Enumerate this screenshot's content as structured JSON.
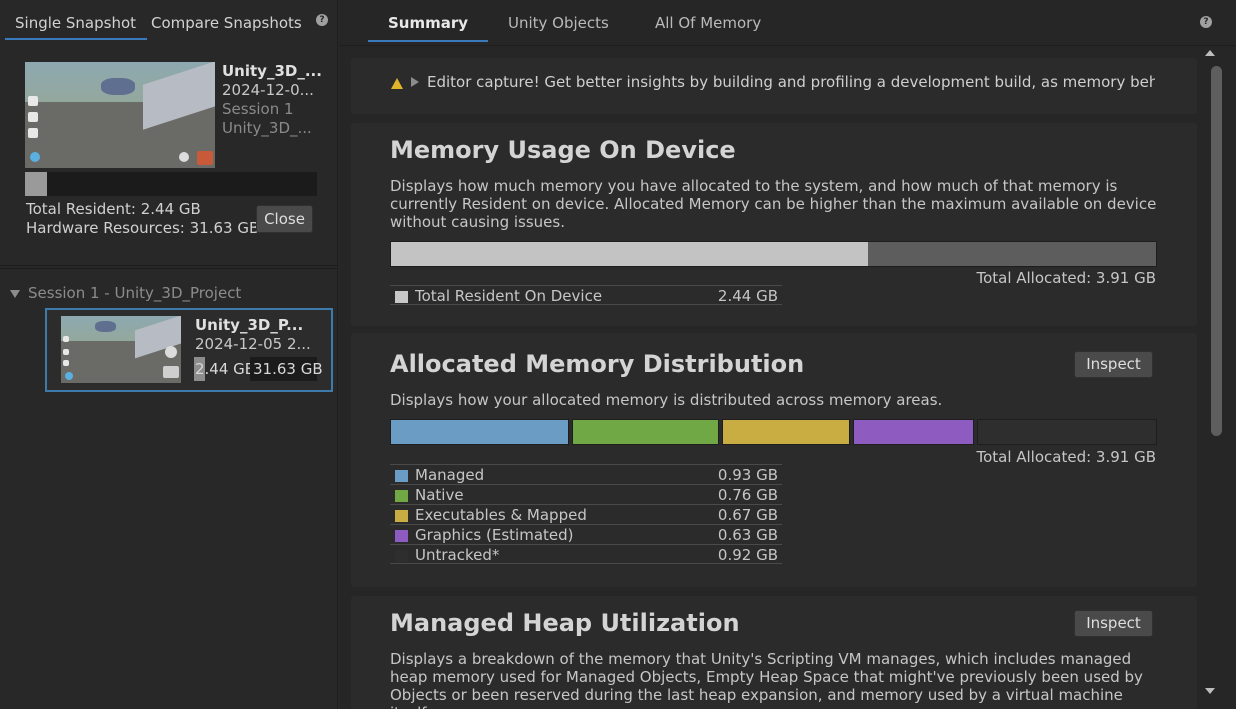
{
  "left_tabs": {
    "single": "Single Snapshot",
    "compare": "Compare Snapshots",
    "help": "?"
  },
  "snapshot": {
    "title": "Unity_3D_...",
    "date": "2024-12-0...",
    "session": "Session 1",
    "project": "Unity_3D_...",
    "usage_fraction": 0.077,
    "total_resident": "Total Resident: 2.44 GB",
    "hardware_resources": "Hardware Resources: 31.63 GB",
    "close_label": "Close"
  },
  "session_tree": {
    "header": "Session 1 - Unity_3D_Project",
    "item": {
      "title": "Unity_3D_P...",
      "date": "2024-12-05 2...",
      "resident": "2.44 GB",
      "hardware": "31.63 GB"
    }
  },
  "right_tabs": {
    "summary": "Summary",
    "objects": "Unity Objects",
    "all": "All Of Memory",
    "help": "?"
  },
  "warning": "Editor capture! Get better insights by building and profiling a development build, as memory behaves q",
  "memory_usage": {
    "title": "Memory Usage On Device",
    "description": "Displays how much memory you have allocated to the system, and how much of that memory is currently Resident on device. Allocated Memory can be higher than the maximum available on device without causing issues.",
    "resident_fraction": 0.624,
    "total_allocated": "Total Allocated: 3.91 GB",
    "legend": [
      {
        "name": "Total Resident On Device",
        "value": "2.44 GB",
        "color": "#c8c8c8"
      }
    ]
  },
  "allocated_distribution": {
    "title": "Allocated Memory Distribution",
    "inspect_label": "Inspect",
    "description": "Displays how your allocated memory is distributed across memory areas.",
    "total_allocated": "Total Allocated: 3.91 GB",
    "legend": [
      {
        "name": "Managed",
        "value": "0.93 GB",
        "color": "#6a9cc4"
      },
      {
        "name": "Native",
        "value": "0.76 GB",
        "color": "#6fa844"
      },
      {
        "name": "Executables & Mapped",
        "value": "0.67 GB",
        "color": "#c9ac42"
      },
      {
        "name": "Graphics (Estimated)",
        "value": "0.63 GB",
        "color": "#8e5bc0"
      },
      {
        "name": "Untracked*",
        "value": "0.92 GB",
        "color": "#2e2e2e"
      }
    ]
  },
  "managed_heap": {
    "title": "Managed Heap Utilization",
    "inspect_label": "Inspect",
    "description": "Displays a breakdown of the memory that Unity's Scripting VM manages, which includes managed heap memory used for Managed Objects, Empty Heap Space that might've previously been used by Objects or been reserved during the last heap expansion, and memory used by a virtual machine itself."
  }
}
